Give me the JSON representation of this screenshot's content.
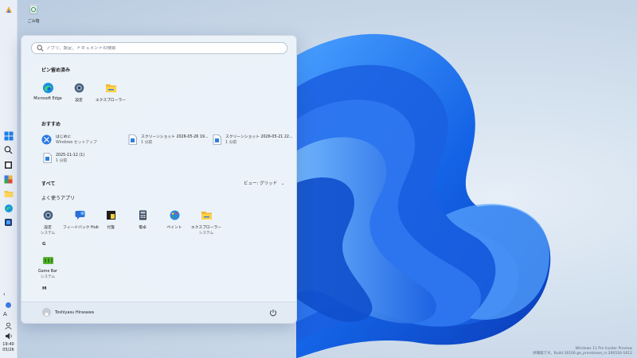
{
  "desktop": {
    "recycle_bin_label": "ごみ箱",
    "watermark_line1": "Windows 11 Pro Insider Preview",
    "watermark_line2": "評価版です。Build 26100.ge_prerelease_rs.260516-1612"
  },
  "taskbar": {
    "clock_time": "19:40",
    "clock_date": "05/26",
    "chevron": "›",
    "ime": "A",
    "volume": "🔊"
  },
  "start_menu": {
    "search_placeholder": "アプリ、設定、ドキュメントの検索",
    "pinned_title": "ピン留め済み",
    "pinned": [
      {
        "label": "Microsoft Edge",
        "icon": "edge-icon"
      },
      {
        "label": "設定",
        "icon": "settings-icon"
      },
      {
        "label": "エクスプローラー",
        "icon": "explorer-icon"
      }
    ],
    "recommended_title": "おすすめ",
    "recommended": [
      {
        "title": "はじめに",
        "subtitle": "Windows セットアップ",
        "icon": "get-started-icon"
      },
      {
        "title": "スクリーンショット 2026-05-26 19...",
        "subtitle": "1 分前",
        "icon": "file-icon"
      },
      {
        "title": "スクリーンショット 2026-05-21 22...",
        "subtitle": "1 分前",
        "icon": "file-icon"
      },
      {
        "title": "2025-11-12 (1)",
        "subtitle": "1 分前",
        "icon": "file-icon"
      }
    ],
    "all_title": "すべて",
    "view_label": "ビュー: グリッド",
    "frequent_title": "よく使うアプリ",
    "frequent": [
      {
        "label": "設定",
        "subtitle": "システム",
        "icon": "settings-icon"
      },
      {
        "label": "フィードバック Hub",
        "subtitle": "",
        "icon": "feedback-icon"
      },
      {
        "label": "付箋",
        "subtitle": "",
        "icon": "sticky-notes-icon"
      },
      {
        "label": "電卓",
        "subtitle": "",
        "icon": "calculator-icon"
      },
      {
        "label": "ペイント",
        "subtitle": "",
        "icon": "paint-icon"
      },
      {
        "label": "エクスプローラー",
        "subtitle": "システム",
        "icon": "explorer-icon"
      }
    ],
    "group_g": "G",
    "game_bar": {
      "label": "Game Bar",
      "subtitle": "システム"
    },
    "group_m": "M",
    "user_name": "Toshiyasu Hirasawa"
  }
}
